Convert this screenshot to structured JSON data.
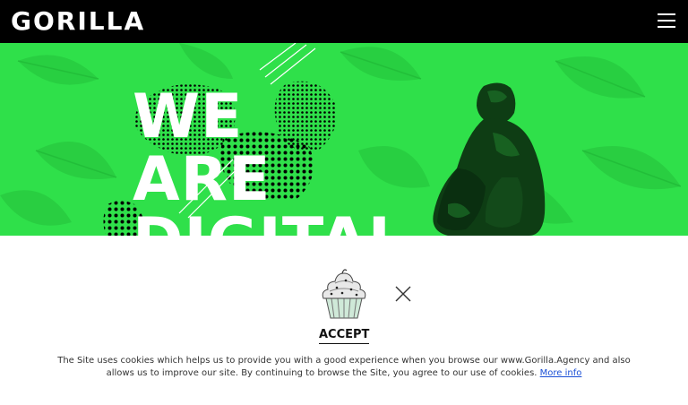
{
  "header": {
    "logo_text": "GORILLA",
    "menu_icon": "hamburger-menu-icon"
  },
  "hero": {
    "line1": "WE",
    "line2": "ARE",
    "line3": "DIGITAL",
    "image": "gorilla-image",
    "bg_color": "#2fe04a"
  },
  "cookie_banner": {
    "image": "cupcake-icon",
    "close_icon": "close-icon",
    "accept_label": "ACCEPT",
    "message": "The Site uses cookies which helps us to provide you with a good experience when you browse our www.Gorilla.Agency and also allows us to improve our site. By continuing to browse the Site, you agree to our use of cookies.",
    "link_label": "More info"
  }
}
